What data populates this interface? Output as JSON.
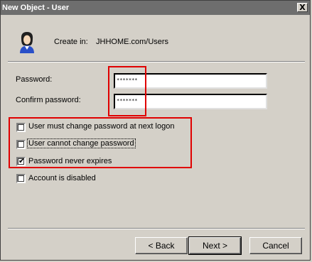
{
  "window": {
    "title": "New Object - User",
    "close_glyph": "X"
  },
  "header": {
    "icon": "user-icon",
    "create_in_label": "Create in:",
    "create_in_value": "JHHOME.com/Users"
  },
  "fields": {
    "password_label": "Password:",
    "password_value": "*******",
    "confirm_label": "Confirm password:",
    "confirm_value": "*******"
  },
  "options": {
    "must_change": {
      "label": "User must change password at next logon",
      "checked": false
    },
    "cannot_change": {
      "label": "User cannot change password",
      "checked": false
    },
    "never_expires": {
      "label": "Password never expires",
      "checked": true
    },
    "disabled": {
      "label": "Account is disabled",
      "checked": false
    }
  },
  "buttons": {
    "back": "< Back",
    "next": "Next >",
    "cancel": "Cancel"
  },
  "colors": {
    "titlebar": "#6e6e6e",
    "dialog_bg": "#d4d0c8",
    "highlight_box": "#e00000"
  }
}
